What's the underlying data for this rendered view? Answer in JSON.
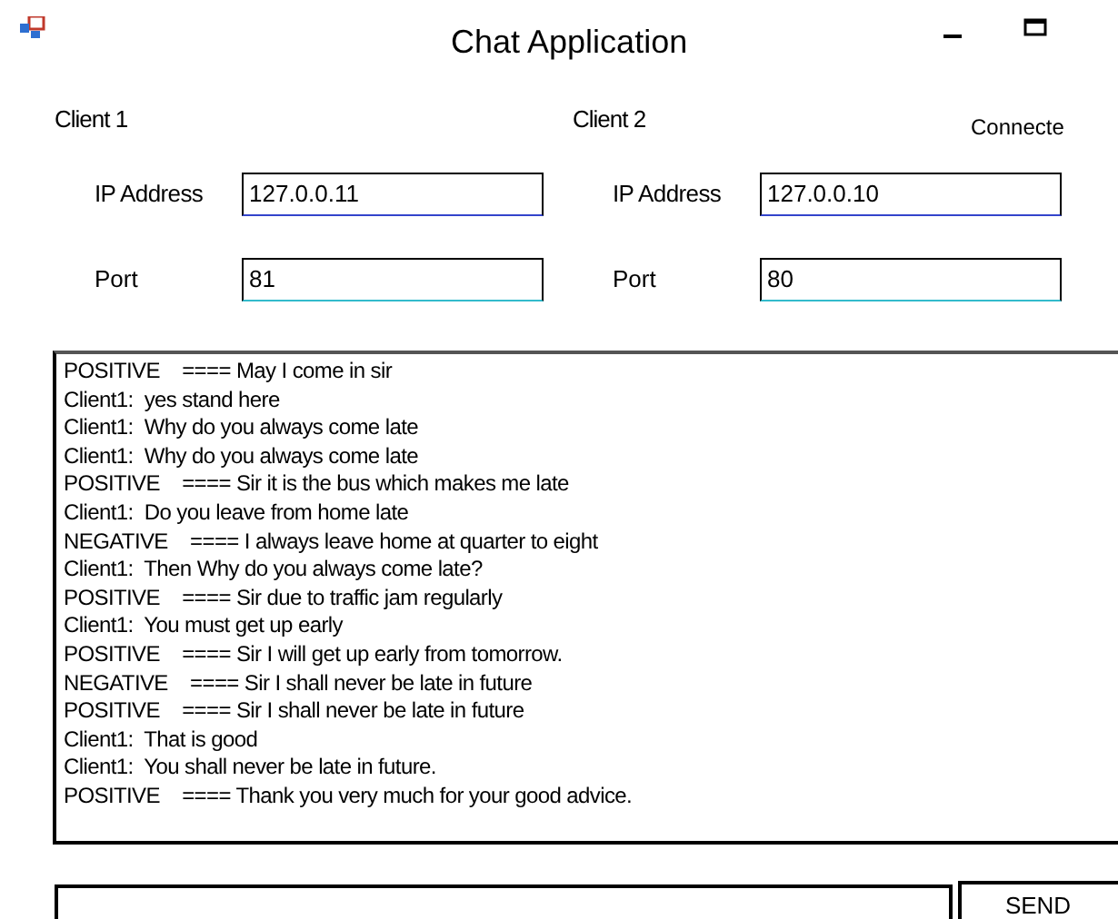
{
  "window": {
    "title": "Chat Application"
  },
  "clients": [
    {
      "heading": "Client 1",
      "ip_label": "IP Address",
      "ip": "127.0.0.11",
      "port_label": "Port",
      "port": "81"
    },
    {
      "heading": "Client 2",
      "ip_label": "IP Address",
      "ip": "127.0.0.10",
      "port_label": "Port",
      "port": "80"
    }
  ],
  "status": "Connecte",
  "messages": [
    "POSITIVE    ==== May I come in sir",
    "Client1:  yes stand here",
    "Client1:  Why do you always come late",
    "Client1:  Why do you always come late",
    "POSITIVE    ==== Sir it is the bus which makes me late",
    "Client1:  Do you leave from home late",
    "NEGATIVE    ==== I always leave home at quarter to eight",
    "Client1:  Then Why do you always come late?",
    "POSITIVE    ==== Sir due to traffic jam regularly",
    "Client1:  You must get up early",
    "POSITIVE    ==== Sir I will get up early from tomorrow.",
    "NEGATIVE    ==== Sir I shall never be late in future",
    "POSITIVE    ==== Sir I shall never be late in future",
    "Client1:  That is good",
    "Client1:  You shall never be late in future.",
    "POSITIVE    ==== Thank you very much for your good advice."
  ],
  "send_button": "SEND"
}
